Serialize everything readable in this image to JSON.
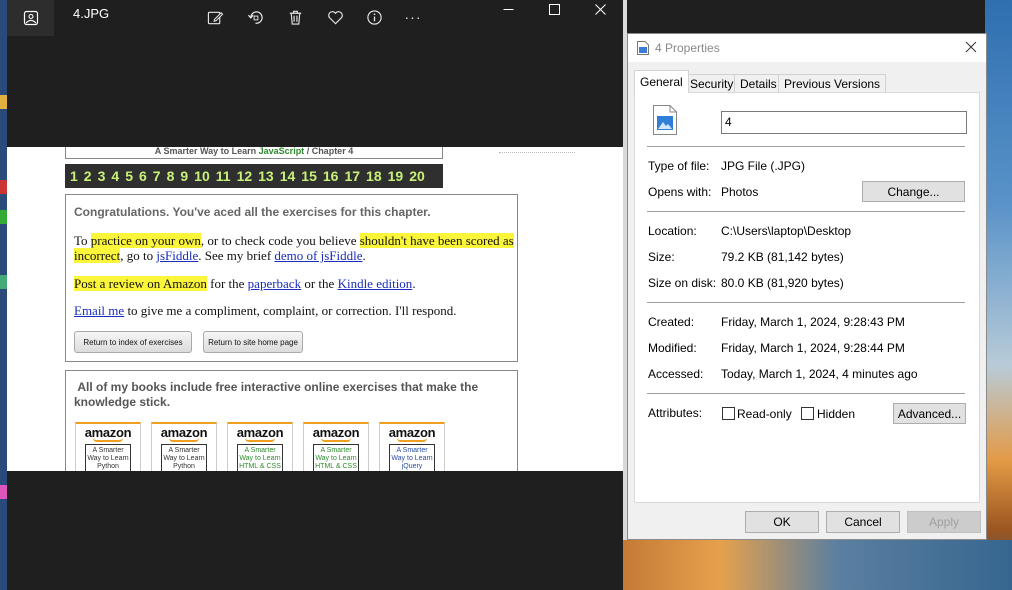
{
  "photos": {
    "title": "4.JPG",
    "toolbar": [
      "edit",
      "rotate",
      "delete",
      "favorite",
      "info",
      "more"
    ],
    "more_label": "···"
  },
  "image_content": {
    "chapter_header": {
      "prefix": "A Smarter Way to Learn ",
      "js": "JavaScript",
      "suffix": " / Chapter 4"
    },
    "numbers": [
      "1",
      "2",
      "3",
      "4",
      "5",
      "6",
      "7",
      "8",
      "9",
      "10",
      "11",
      "12",
      "13",
      "14",
      "15",
      "16",
      "17",
      "18",
      "19",
      "20"
    ],
    "congrats": "Congratulations. You've aced all the exercises for this chapter.",
    "p1": {
      "t1": "To ",
      "h1": "practice on your own",
      "t2": ", or to check code you believe ",
      "h2": "shouldn't have been scored as incorrect",
      "t3": ", go to ",
      "l1": "jsFiddle",
      "t4": ". See my brief ",
      "l2": "demo of jsFiddle",
      "t5": "."
    },
    "p2": {
      "h1": "Post a review on Amazon",
      "t1": " for the ",
      "l1": "paperback",
      "t2": " or the ",
      "l2": "Kindle edition",
      "t3": "."
    },
    "p3": {
      "l1": "Email me",
      "t1": " to give me a compliment, complaint, or correction. I'll respond."
    },
    "btn_index": "Return to index of exercises",
    "btn_home": "Return to site home page",
    "books_heading": "All of my books include free interactive online exercises that make the knowledge stick.",
    "books": [
      {
        "brand": "amazon",
        "cover": "A Smarter Way to Learn Python"
      },
      {
        "brand": "amazon",
        "cover": "A Smarter Way to Learn Python"
      },
      {
        "brand": "amazon",
        "cover": "A Smarter Way to Learn HTML & CSS"
      },
      {
        "brand": "amazon",
        "cover": "A Smarter Way to Learn HTML & CSS"
      },
      {
        "brand": "amazon",
        "cover": "A Smarter Way to Learn jQuery"
      }
    ]
  },
  "dialog": {
    "title": "4 Properties",
    "tabs": [
      "General",
      "Security",
      "Details",
      "Previous Versions"
    ],
    "name": "4",
    "type_label": "Type of file:",
    "type_value": "JPG File (.JPG)",
    "opens_label": "Opens with:",
    "opens_value": "Photos",
    "change_btn": "Change...",
    "location_label": "Location:",
    "location_value": "C:\\Users\\laptop\\Desktop",
    "size_label": "Size:",
    "size_value": "79.2 KB (81,142 bytes)",
    "sizedisk_label": "Size on disk:",
    "sizedisk_value": "80.0 KB (81,920 bytes)",
    "created_label": "Created:",
    "created_value": "Friday, March 1, 2024, 9:28:43 PM",
    "modified_label": "Modified:",
    "modified_value": "Friday, March 1, 2024, 9:28:44 PM",
    "accessed_label": "Accessed:",
    "accessed_value": "Today, March 1, 2024, 4 minutes ago",
    "attributes_label": "Attributes:",
    "readonly_label": "Read-only",
    "hidden_label": "Hidden",
    "advanced_btn": "Advanced...",
    "ok": "OK",
    "cancel": "Cancel",
    "apply": "Apply"
  }
}
